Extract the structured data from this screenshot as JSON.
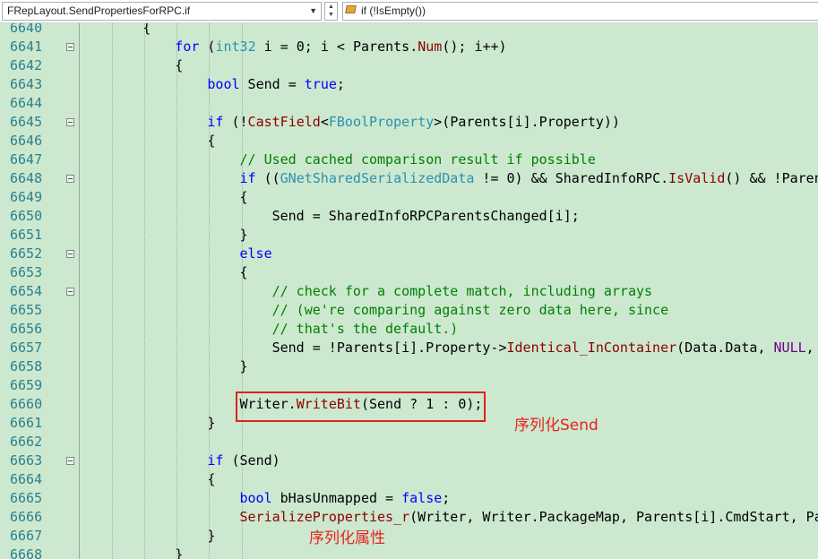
{
  "toolbar": {
    "scope_dropdown": "FRepLayout.SendPropertiesForRPC.if",
    "member_dropdown": "if (!IsEmpty())"
  },
  "editor": {
    "lines": [
      {
        "n": "6640",
        "fold": false,
        "indent": 2,
        "tokens": [
          [
            "p",
            "{"
          ]
        ]
      },
      {
        "n": "6641",
        "fold": true,
        "indent": 3,
        "tokens": [
          [
            "k",
            "for"
          ],
          [
            "p",
            " ("
          ],
          [
            "t",
            "int32"
          ],
          [
            "p",
            " i = 0; i < Parents."
          ],
          [
            "f",
            "Num"
          ],
          [
            "p",
            "(); i++)"
          ]
        ]
      },
      {
        "n": "6642",
        "fold": false,
        "indent": 3,
        "tokens": [
          [
            "p",
            "{"
          ]
        ]
      },
      {
        "n": "6643",
        "fold": false,
        "indent": 4,
        "tokens": [
          [
            "k",
            "bool"
          ],
          [
            "p",
            " Send = "
          ],
          [
            "k",
            "true"
          ],
          [
            "p",
            ";"
          ]
        ]
      },
      {
        "n": "6644",
        "fold": false,
        "indent": 0,
        "tokens": []
      },
      {
        "n": "6645",
        "fold": true,
        "indent": 4,
        "tokens": [
          [
            "k",
            "if"
          ],
          [
            "p",
            " (!"
          ],
          [
            "f",
            "CastField"
          ],
          [
            "p",
            "<"
          ],
          [
            "t",
            "FBoolProperty"
          ],
          [
            "p",
            ">(Parents[i].Property))"
          ]
        ]
      },
      {
        "n": "6646",
        "fold": false,
        "indent": 4,
        "tokens": [
          [
            "p",
            "{"
          ]
        ]
      },
      {
        "n": "6647",
        "fold": false,
        "indent": 5,
        "tokens": [
          [
            "c",
            "// Used cached comparison result if possible"
          ]
        ]
      },
      {
        "n": "6648",
        "fold": true,
        "indent": 5,
        "tokens": [
          [
            "k",
            "if"
          ],
          [
            "p",
            " (("
          ],
          [
            "t",
            "GNetSharedSerializedData"
          ],
          [
            "p",
            " != 0) && SharedInfoRPC."
          ],
          [
            "f",
            "IsValid"
          ],
          [
            "p",
            "() && !Parent"
          ]
        ]
      },
      {
        "n": "6649",
        "fold": false,
        "indent": 5,
        "tokens": [
          [
            "p",
            "{"
          ]
        ]
      },
      {
        "n": "6650",
        "fold": false,
        "indent": 6,
        "tokens": [
          [
            "p",
            "Send = SharedInfoRPCParentsChanged[i];"
          ]
        ]
      },
      {
        "n": "6651",
        "fold": false,
        "indent": 5,
        "tokens": [
          [
            "p",
            "}"
          ]
        ]
      },
      {
        "n": "6652",
        "fold": true,
        "indent": 5,
        "tokens": [
          [
            "k",
            "else"
          ]
        ]
      },
      {
        "n": "6653",
        "fold": false,
        "indent": 5,
        "tokens": [
          [
            "p",
            "{"
          ]
        ]
      },
      {
        "n": "6654",
        "fold": true,
        "indent": 6,
        "tokens": [
          [
            "c",
            "// check for a complete match, including arrays"
          ]
        ]
      },
      {
        "n": "6655",
        "fold": false,
        "indent": 6,
        "tokens": [
          [
            "c",
            "// (we're comparing against zero data here, since"
          ]
        ]
      },
      {
        "n": "6656",
        "fold": false,
        "indent": 6,
        "tokens": [
          [
            "c",
            "// that's the default.)"
          ]
        ]
      },
      {
        "n": "6657",
        "fold": false,
        "indent": 6,
        "tokens": [
          [
            "p",
            "Send = !Parents[i].Property->"
          ],
          [
            "f",
            "Identical_InContainer"
          ],
          [
            "p",
            "(Data.Data, "
          ],
          [
            "m",
            "NULL"
          ],
          [
            "p",
            ", "
          ]
        ]
      },
      {
        "n": "6658",
        "fold": false,
        "indent": 5,
        "tokens": [
          [
            "p",
            "}"
          ]
        ]
      },
      {
        "n": "6659",
        "fold": false,
        "indent": 0,
        "tokens": []
      },
      {
        "n": "6660",
        "fold": false,
        "indent": 5,
        "tokens": [
          [
            "p",
            "Writer."
          ],
          [
            "f",
            "WriteBit"
          ],
          [
            "p",
            "(Send ? 1 : 0);"
          ]
        ]
      },
      {
        "n": "6661",
        "fold": false,
        "indent": 4,
        "tokens": [
          [
            "p",
            "}"
          ]
        ]
      },
      {
        "n": "6662",
        "fold": false,
        "indent": 0,
        "tokens": []
      },
      {
        "n": "6663",
        "fold": true,
        "indent": 4,
        "tokens": [
          [
            "k",
            "if"
          ],
          [
            "p",
            " (Send)"
          ]
        ]
      },
      {
        "n": "6664",
        "fold": false,
        "indent": 4,
        "tokens": [
          [
            "p",
            "{"
          ]
        ]
      },
      {
        "n": "6665",
        "fold": false,
        "indent": 5,
        "tokens": [
          [
            "k",
            "bool"
          ],
          [
            "p",
            " bHasUnmapped = "
          ],
          [
            "k",
            "false"
          ],
          [
            "p",
            ";"
          ]
        ]
      },
      {
        "n": "6666",
        "fold": false,
        "indent": 5,
        "tokens": [
          [
            "f",
            "SerializeProperties_r"
          ],
          [
            "p",
            "(Writer, Writer.PackageMap, Parents[i].CmdStart, Pa"
          ]
        ]
      },
      {
        "n": "6667",
        "fold": false,
        "indent": 4,
        "tokens": [
          [
            "p",
            "}"
          ]
        ]
      },
      {
        "n": "6668",
        "fold": false,
        "indent": 3,
        "tokens": [
          [
            "p",
            "}"
          ]
        ]
      }
    ]
  },
  "annotations": {
    "serialize_send": "序列化Send",
    "serialize_props": "序列化属性"
  },
  "colors": {
    "editor_bg": "#cce8cf",
    "keyword": "#0000ff",
    "type": "#2b91af",
    "comment": "#008000",
    "function": "#8b0000",
    "annotation_red": "#e8231f"
  }
}
